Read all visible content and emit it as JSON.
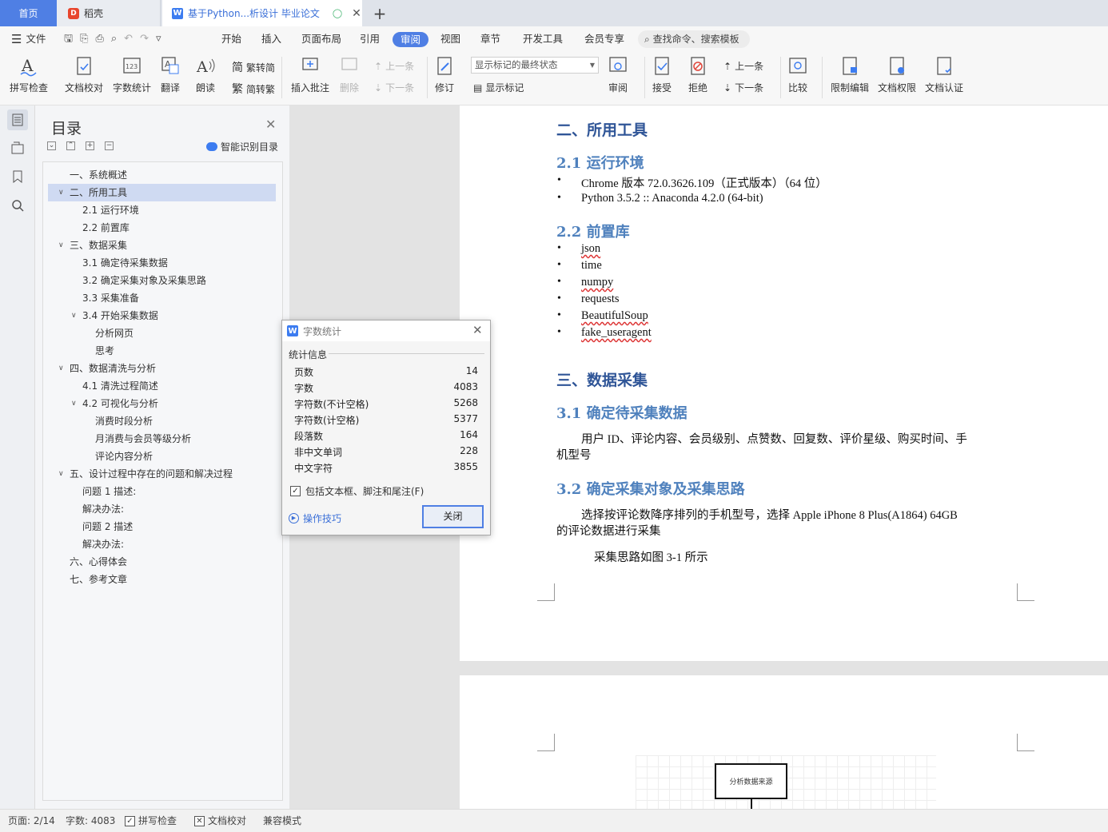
{
  "tabs": {
    "home": "首页",
    "docer": "稻壳",
    "doc": "基于Python...析设计 毕业论文",
    "add": "+"
  },
  "menu": {
    "file": "文件",
    "items": [
      "开始",
      "插入",
      "页面布局",
      "引用",
      "审阅",
      "视图",
      "章节",
      "开发工具",
      "会员专享"
    ],
    "active_index": 4,
    "search": "查找命令、搜索模板"
  },
  "ribbon": {
    "spell": "拼写检查",
    "proof": "文档校对",
    "wordcount": "字数统计",
    "translate": "翻译",
    "read": "朗读",
    "t2s": "繁转简",
    "s2t": "简转繁",
    "insert_comment": "插入批注",
    "delete": "删除",
    "prev": "上一条",
    "next": "下一条",
    "revise": "修订",
    "mark_state": "显示标记的最终状态",
    "show_marks": "显示标记",
    "review": "审阅",
    "accept": "接受",
    "reject": "拒绝",
    "prev2": "上一条",
    "next2": "下一条",
    "compare": "比较",
    "restrict": "限制编辑",
    "perm": "文档权限",
    "cert": "文档认证"
  },
  "toc": {
    "title": "目录",
    "smart": "智能识别目录",
    "items": [
      {
        "label": "一、系统概述",
        "level": 0,
        "chev": false
      },
      {
        "label": "二、所用工具",
        "level": 0,
        "chev": true,
        "selected": true
      },
      {
        "label": "2.1 运行环境",
        "level": 1,
        "chev": false
      },
      {
        "label": "2.2 前置库",
        "level": 1,
        "chev": false
      },
      {
        "label": "三、数据采集",
        "level": 0,
        "chev": true
      },
      {
        "label": "3.1 确定待采集数据",
        "level": 1,
        "chev": false
      },
      {
        "label": "3.2 确定采集对象及采集思路",
        "level": 1,
        "chev": false
      },
      {
        "label": "3.3 采集准备",
        "level": 1,
        "chev": false
      },
      {
        "label": "3.4 开始采集数据",
        "level": 1,
        "chev": true
      },
      {
        "label": "分析网页",
        "level": 2,
        "chev": false
      },
      {
        "label": "思考",
        "level": 2,
        "chev": false
      },
      {
        "label": "四、数据清洗与分析",
        "level": 0,
        "chev": true
      },
      {
        "label": "4.1 清洗过程简述",
        "level": 1,
        "chev": false
      },
      {
        "label": "4.2 可视化与分析",
        "level": 1,
        "chev": true
      },
      {
        "label": "消费时段分析",
        "level": 2,
        "chev": false
      },
      {
        "label": "月消费与会员等级分析",
        "level": 2,
        "chev": false
      },
      {
        "label": "评论内容分析",
        "level": 2,
        "chev": false
      },
      {
        "label": "五、设计过程中存在的问题和解决过程",
        "level": 0,
        "chev": true
      },
      {
        "label": "问题 1 描述:",
        "level": 1,
        "chev": false
      },
      {
        "label": "解决办法:",
        "level": 1,
        "chev": false
      },
      {
        "label": "问题 2 描述",
        "level": 1,
        "chev": false
      },
      {
        "label": "解决办法:",
        "level": 1,
        "chev": false
      },
      {
        "label": "六、心得体会",
        "level": 0,
        "chev": false
      },
      {
        "label": "七、参考文章",
        "level": 0,
        "chev": false
      }
    ]
  },
  "doc": {
    "h_tools": "二、所用工具",
    "h_env": "2.1 运行环境",
    "env": [
      "Chrome 版本 72.0.3626.109（正式版本）（64 位）",
      "Python 3.5.2 :: Anaconda 4.2.0 (64-bit)"
    ],
    "h_libs": "2.2 前置库",
    "libs": [
      "json",
      "time",
      "numpy",
      "requests",
      "BeautifulSoup",
      "fake_useragent"
    ],
    "h_collect": "三、数据采集",
    "h_31": "3.1 确定待采集数据",
    "p_31a": "用户 ID、评论内容、会员级别、点赞数、回复数、评价星级、购买时间、手",
    "p_31b": "机型号",
    "h_32": "3.2 确定采集对象及采集思路",
    "p_32a": "选择按评论数降序排列的手机型号，选择 Apple iPhone 8 Plus(A1864) 64GB",
    "p_32b": "的评论数据进行采集",
    "p_32c": "采集思路如图 3-1 所示",
    "flow_box": "分析数据来源"
  },
  "dialog": {
    "title": "字数统计",
    "section": "统计信息",
    "rows": [
      {
        "label": "页数",
        "value": "14"
      },
      {
        "label": "字数",
        "value": "4083"
      },
      {
        "label": "字符数(不计空格)",
        "value": "5268"
      },
      {
        "label": "字符数(计空格)",
        "value": "5377"
      },
      {
        "label": "段落数",
        "value": "164"
      },
      {
        "label": "非中文单词",
        "value": "228"
      },
      {
        "label": "中文字符",
        "value": "3855"
      }
    ],
    "checkbox": "包括文本框、脚注和尾注(F)",
    "tips": "操作技巧",
    "close": "关闭"
  },
  "status": {
    "page": "页面: 2/14",
    "words": "字数: 4083",
    "spell": "拼写检查",
    "proof": "文档校对",
    "compat": "兼容模式"
  }
}
